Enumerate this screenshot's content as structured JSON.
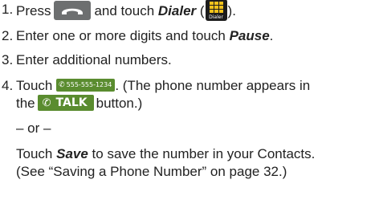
{
  "steps": [
    {
      "number": "1.",
      "pre": "Press",
      "mid": "and touch",
      "dialer_label": "Dialer",
      "open_paren": "(",
      "close_paren": ").",
      "phone_button_icon": "phone-handset-icon",
      "dialer_icon": "dialer-keypad-icon",
      "dialer_icon_caption": "Dialer"
    },
    {
      "number": "2.",
      "text": "Enter one or more digits and touch",
      "pause_label": "Pause",
      "end": "."
    },
    {
      "number": "3.",
      "text": "Enter additional numbers."
    },
    {
      "number": "4.",
      "pre": "Touch",
      "number_button_text": "555-555-1234",
      "post": ". (The phone number appears in",
      "line2_pre": "the",
      "talk_button_text": "TALK",
      "line2_post": "button.)",
      "or_text": "– or –",
      "touch_pre": "Touch",
      "save_label": "Save",
      "touch_post": "to save the number in your Contacts.",
      "see_text": "(See “Saving a Phone Number” on page 32.)"
    }
  ],
  "colors": {
    "text": "#222222",
    "phone_button": "#6d6f70",
    "dialer_icon_bg": "#1c1c1c",
    "dialer_keys": "#f2c21b",
    "green_button": "#5a8c2f"
  }
}
